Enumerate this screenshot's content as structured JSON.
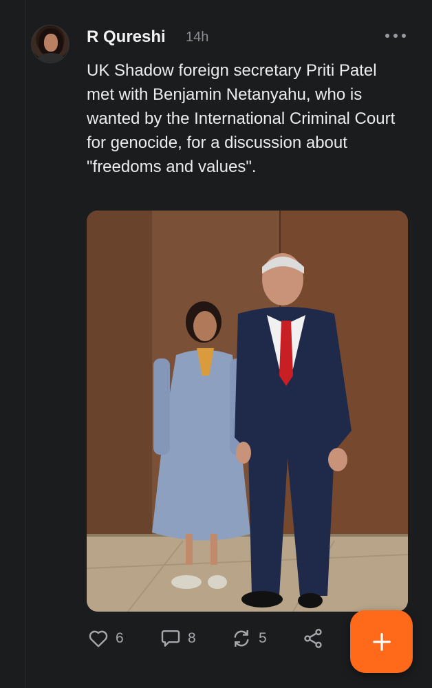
{
  "post": {
    "author": "R Qureshi",
    "time": "14h",
    "text": "UK Shadow foreign secretary Priti Patel met with Benjamin Netanyahu, who is wanted by the International Criminal Court for genocide, for a discussion about \"freedoms and values\"."
  },
  "actions": {
    "likes": "6",
    "comments": "8",
    "reposts": "5"
  },
  "icons": {
    "more": "more-horizontal-icon",
    "like": "heart-icon",
    "comment": "comment-icon",
    "repost": "repost-icon",
    "share": "share-icon",
    "compose": "plus-icon"
  },
  "colors": {
    "background": "#1b1c1e",
    "accent": "#ff6a1a",
    "muted": "#8b8c90"
  }
}
